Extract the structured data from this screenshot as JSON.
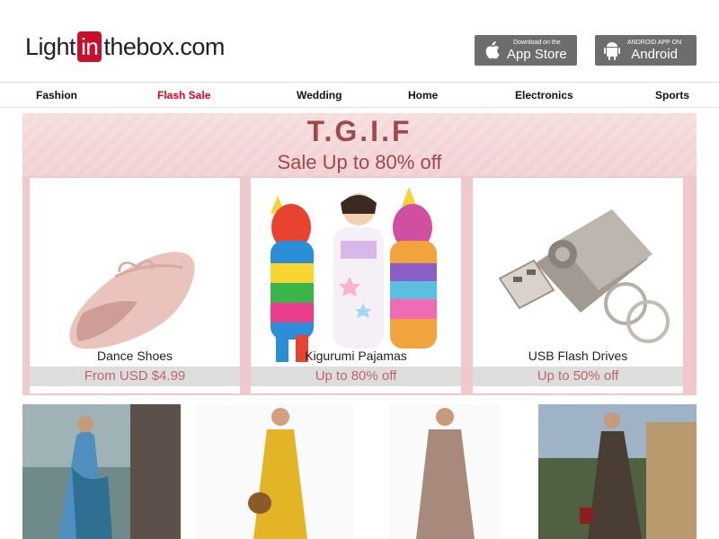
{
  "header": {
    "logo": {
      "pre": "Light",
      "mid": "in",
      "post": "thebox.com"
    },
    "app_store": {
      "small": "Download on the",
      "big": "App Store"
    },
    "android": {
      "small": "ANDROID APP ON",
      "big": "Android"
    }
  },
  "nav": [
    "Fashion",
    "Flash Sale",
    "Wedding",
    "Home",
    "Electronics",
    "Sports"
  ],
  "banner": {
    "title": "T.G.I.F",
    "subtitle": "Sale Up to 80% off",
    "cards": [
      {
        "name": "Dance Shoes",
        "price": "From USD $4.99"
      },
      {
        "name": "Kigurumi Pajamas",
        "price": "Up to 80% off"
      },
      {
        "name": "USB Flash Drives",
        "price": "Up to 50% off"
      }
    ]
  },
  "colors": {
    "accent": "#c8102e",
    "flash_sale": "#e8001c",
    "banner_text": "#9d4b4a"
  }
}
